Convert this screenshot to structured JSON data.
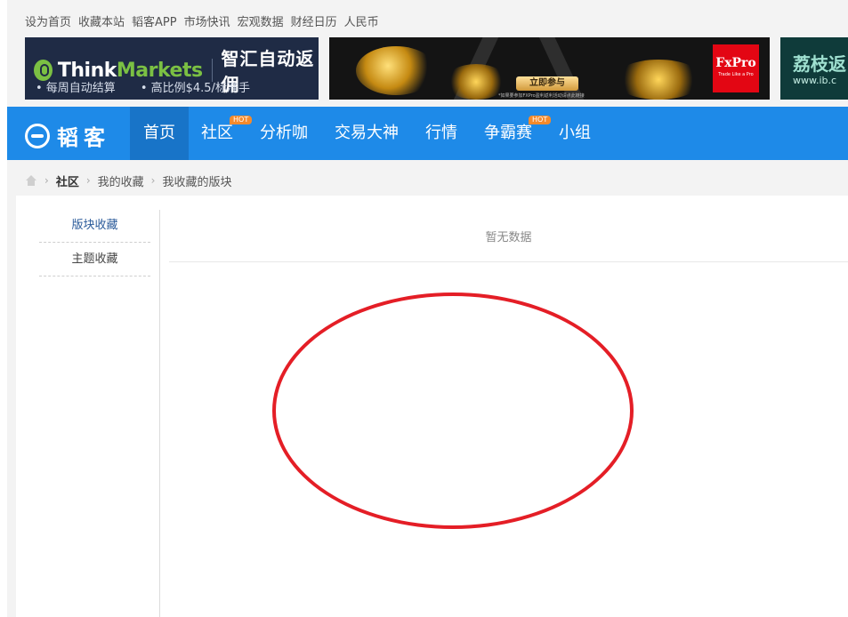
{
  "top_links": [
    "设为首页",
    "收藏本站",
    "韬客APP",
    "市场快讯",
    "宏观数据",
    "财经日历",
    "人民币"
  ],
  "banners": {
    "thinkmarkets": {
      "brand_white": "Think",
      "brand_green": "Markets",
      "cn_title": "智汇自动返佣",
      "bullet1": "• 每周自动结算",
      "bullet2": "• 高比例$4.5/标准手"
    },
    "fxpro": {
      "cta": "立即参与",
      "fine_print": "*如果要参加FXPro盈利返利活动请点此链接",
      "logo_text": "FxPro",
      "logo_sub": "Trade Like a Pro"
    },
    "ib": {
      "title": "荔枝返",
      "url": "www.ib.c"
    }
  },
  "nav": {
    "logo_text": "韬客",
    "items": [
      {
        "label": "首页",
        "active": true,
        "hot": false
      },
      {
        "label": "社区",
        "active": false,
        "hot": true
      },
      {
        "label": "分析咖",
        "active": false,
        "hot": false
      },
      {
        "label": "交易大神",
        "active": false,
        "hot": false
      },
      {
        "label": "行情",
        "active": false,
        "hot": false
      },
      {
        "label": "争霸赛",
        "active": false,
        "hot": true
      },
      {
        "label": "小组",
        "active": false,
        "hot": false
      }
    ],
    "hot_label": "HOT"
  },
  "breadcrumb": [
    "社区",
    "我的收藏",
    "我收藏的版块"
  ],
  "sidebar": {
    "items": [
      {
        "label": "版块收藏",
        "active": true
      },
      {
        "label": "主题收藏",
        "active": false
      }
    ]
  },
  "main": {
    "empty_text": "暂无数据"
  },
  "colors": {
    "nav_bg": "#1e8ae8",
    "nav_active": "#1874c8",
    "hot_badge": "#f58a2b",
    "annotation": "#e41e26"
  }
}
